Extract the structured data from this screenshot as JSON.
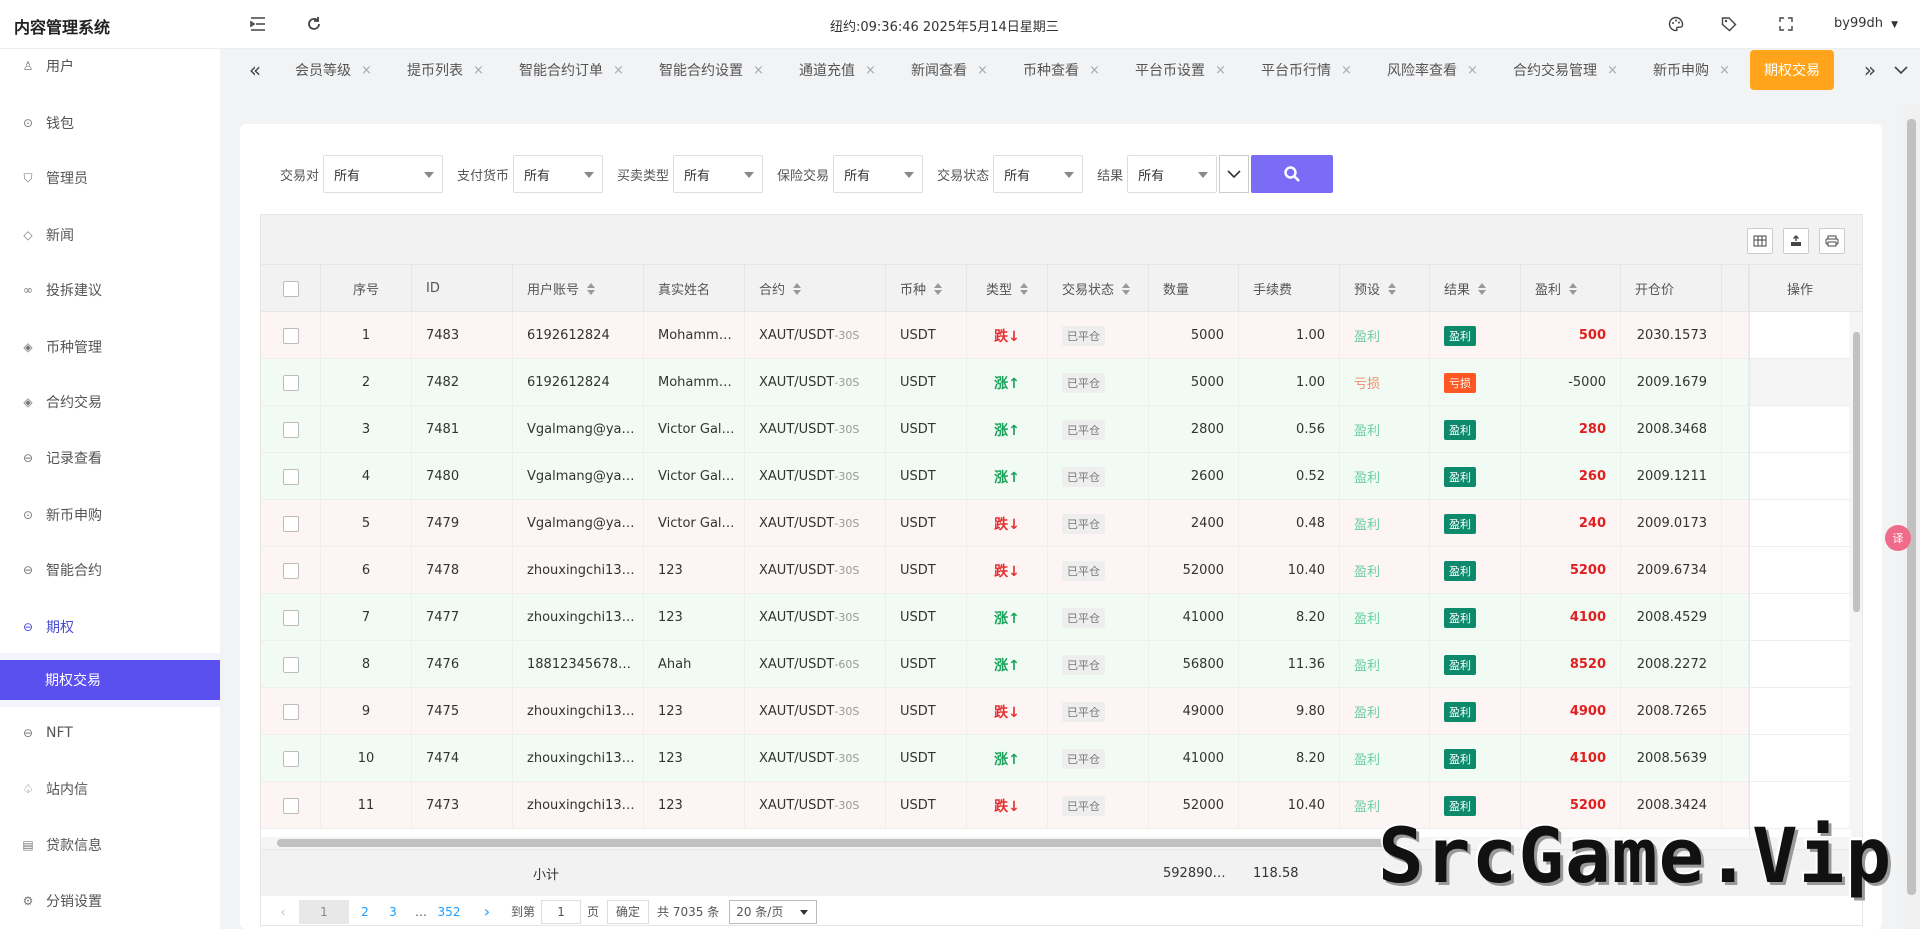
{
  "app": {
    "title": "内容管理系统",
    "clock": "纽约:09:36:46 2025年5月14日星期三",
    "user": "by99dh"
  },
  "icons": {
    "menu": "menu-fold-icon",
    "refresh": "refresh-icon",
    "theme": "palette-icon",
    "tag": "tag-icon",
    "fullscreen": "fullscreen-icon"
  },
  "sidebar": {
    "items": [
      {
        "label": "用户",
        "icon": "user-icon"
      },
      {
        "label": "钱包",
        "icon": "wallet-icon"
      },
      {
        "label": "管理员",
        "icon": "shield-icon"
      },
      {
        "label": "新闻",
        "icon": "tag-icon"
      },
      {
        "label": "投拆建议",
        "icon": "link-icon"
      },
      {
        "label": "币种管理",
        "icon": "diamond-icon"
      },
      {
        "label": "合约交易",
        "icon": "diamond-icon"
      },
      {
        "label": "记录查看",
        "icon": "record-icon"
      },
      {
        "label": "新币申购",
        "icon": "coin-icon"
      },
      {
        "label": "智能合约",
        "icon": "record-icon"
      },
      {
        "label": "期权",
        "icon": "record-icon"
      },
      {
        "label": "NFT",
        "icon": "record-icon"
      },
      {
        "label": "站内信",
        "icon": "bell-icon"
      },
      {
        "label": "贷款信息",
        "icon": "doc-icon"
      },
      {
        "label": "分销设置",
        "icon": "gear-icon"
      }
    ],
    "active_sub": "期权交易"
  },
  "tabs": {
    "items": [
      "会员等级",
      "提币列表",
      "智能合约订单",
      "智能合约设置",
      "通道充值",
      "新闻查看",
      "币种查看",
      "平台币设置",
      "平台币行情",
      "风险率查看",
      "合约交易管理",
      "新币申购"
    ],
    "active": "期权交易"
  },
  "filters": [
    {
      "label": "交易对",
      "value": "所有"
    },
    {
      "label": "支付货币",
      "value": "所有"
    },
    {
      "label": "买卖类型",
      "value": "所有"
    },
    {
      "label": "保险交易",
      "value": "所有"
    },
    {
      "label": "交易状态",
      "value": "所有"
    },
    {
      "label": "结果",
      "value": "所有"
    }
  ],
  "table": {
    "headers": [
      "序号",
      "ID",
      "用户账号",
      "真实姓名",
      "合约",
      "币种",
      "类型",
      "交易状态",
      "数量",
      "手续费",
      "预设",
      "结果",
      "盈利",
      "开仓价",
      "操作"
    ],
    "rows": [
      {
        "seq": "1",
        "id": "7483",
        "account": "6192612824",
        "name": "Mohamm…",
        "pair": "XAUT/USDT",
        "period": "-30S",
        "coin": "USDT",
        "type": "跌↓",
        "dir": "down",
        "status": "已平仓",
        "qty": "5000",
        "fee": "1.00",
        "preset": "盈利",
        "presetWin": true,
        "result": "盈利",
        "resultWin": true,
        "pnl": "500",
        "open": "2030.1573"
      },
      {
        "seq": "2",
        "id": "7482",
        "account": "6192612824",
        "name": "Mohamm…",
        "pair": "XAUT/USDT",
        "period": "-30S",
        "coin": "USDT",
        "type": "涨↑",
        "dir": "up",
        "status": "已平仓",
        "qty": "5000",
        "fee": "1.00",
        "preset": "亏损",
        "presetWin": false,
        "result": "亏损",
        "resultWin": false,
        "pnl": "-5000",
        "open": "2009.1679"
      },
      {
        "seq": "3",
        "id": "7481",
        "account": "Vgalmang@ya…",
        "name": "Victor Gal…",
        "pair": "XAUT/USDT",
        "period": "-30S",
        "coin": "USDT",
        "type": "涨↑",
        "dir": "up",
        "status": "已平仓",
        "qty": "2800",
        "fee": "0.56",
        "preset": "盈利",
        "presetWin": true,
        "result": "盈利",
        "resultWin": true,
        "pnl": "280",
        "open": "2008.3468"
      },
      {
        "seq": "4",
        "id": "7480",
        "account": "Vgalmang@ya…",
        "name": "Victor Gal…",
        "pair": "XAUT/USDT",
        "period": "-30S",
        "coin": "USDT",
        "type": "涨↑",
        "dir": "up",
        "status": "已平仓",
        "qty": "2600",
        "fee": "0.52",
        "preset": "盈利",
        "presetWin": true,
        "result": "盈利",
        "resultWin": true,
        "pnl": "260",
        "open": "2009.1211"
      },
      {
        "seq": "5",
        "id": "7479",
        "account": "Vgalmang@ya…",
        "name": "Victor Gal…",
        "pair": "XAUT/USDT",
        "period": "-30S",
        "coin": "USDT",
        "type": "跌↓",
        "dir": "down",
        "status": "已平仓",
        "qty": "2400",
        "fee": "0.48",
        "preset": "盈利",
        "presetWin": true,
        "result": "盈利",
        "resultWin": true,
        "pnl": "240",
        "open": "2009.0173"
      },
      {
        "seq": "6",
        "id": "7478",
        "account": "zhouxingchi13…",
        "name": "123",
        "pair": "XAUT/USDT",
        "period": "-30S",
        "coin": "USDT",
        "type": "跌↓",
        "dir": "down",
        "status": "已平仓",
        "qty": "52000",
        "fee": "10.40",
        "preset": "盈利",
        "presetWin": true,
        "result": "盈利",
        "resultWin": true,
        "pnl": "5200",
        "open": "2009.6734"
      },
      {
        "seq": "7",
        "id": "7477",
        "account": "zhouxingchi13…",
        "name": "123",
        "pair": "XAUT/USDT",
        "period": "-30S",
        "coin": "USDT",
        "type": "涨↑",
        "dir": "up",
        "status": "已平仓",
        "qty": "41000",
        "fee": "8.20",
        "preset": "盈利",
        "presetWin": true,
        "result": "盈利",
        "resultWin": true,
        "pnl": "4100",
        "open": "2008.4529"
      },
      {
        "seq": "8",
        "id": "7476",
        "account": "18812345678…",
        "name": "Ahah",
        "pair": "XAUT/USDT",
        "period": "-60S",
        "coin": "USDT",
        "type": "涨↑",
        "dir": "up",
        "status": "已平仓",
        "qty": "56800",
        "fee": "11.36",
        "preset": "盈利",
        "presetWin": true,
        "result": "盈利",
        "resultWin": true,
        "pnl": "8520",
        "open": "2008.2272"
      },
      {
        "seq": "9",
        "id": "7475",
        "account": "zhouxingchi13…",
        "name": "123",
        "pair": "XAUT/USDT",
        "period": "-30S",
        "coin": "USDT",
        "type": "跌↓",
        "dir": "down",
        "status": "已平仓",
        "qty": "49000",
        "fee": "9.80",
        "preset": "盈利",
        "presetWin": true,
        "result": "盈利",
        "resultWin": true,
        "pnl": "4900",
        "open": "2008.7265"
      },
      {
        "seq": "10",
        "id": "7474",
        "account": "zhouxingchi13…",
        "name": "123",
        "pair": "XAUT/USDT",
        "period": "-30S",
        "coin": "USDT",
        "type": "涨↑",
        "dir": "up",
        "status": "已平仓",
        "qty": "41000",
        "fee": "8.20",
        "preset": "盈利",
        "presetWin": true,
        "result": "盈利",
        "resultWin": true,
        "pnl": "4100",
        "open": "2008.5639"
      },
      {
        "seq": "11",
        "id": "7473",
        "account": "zhouxingchi13…",
        "name": "123",
        "pair": "XAUT/USDT",
        "period": "-30S",
        "coin": "USDT",
        "type": "跌↓",
        "dir": "down",
        "status": "已平仓",
        "qty": "52000",
        "fee": "10.40",
        "preset": "盈利",
        "presetWin": true,
        "result": "盈利",
        "resultWin": true,
        "pnl": "5200",
        "open": "2008.3424"
      }
    ],
    "totals": {
      "label": "小计",
      "qty": "592890…",
      "fee": "118.58"
    }
  },
  "pager": {
    "pages": [
      "1",
      "2",
      "3",
      "…",
      "352"
    ],
    "goto_label": "到第",
    "goto_value": "1",
    "page_unit": "页",
    "confirm": "确定",
    "total": "共 7035 条",
    "page_size": "20 条/页"
  },
  "watermark": "SrcGame.Vip"
}
